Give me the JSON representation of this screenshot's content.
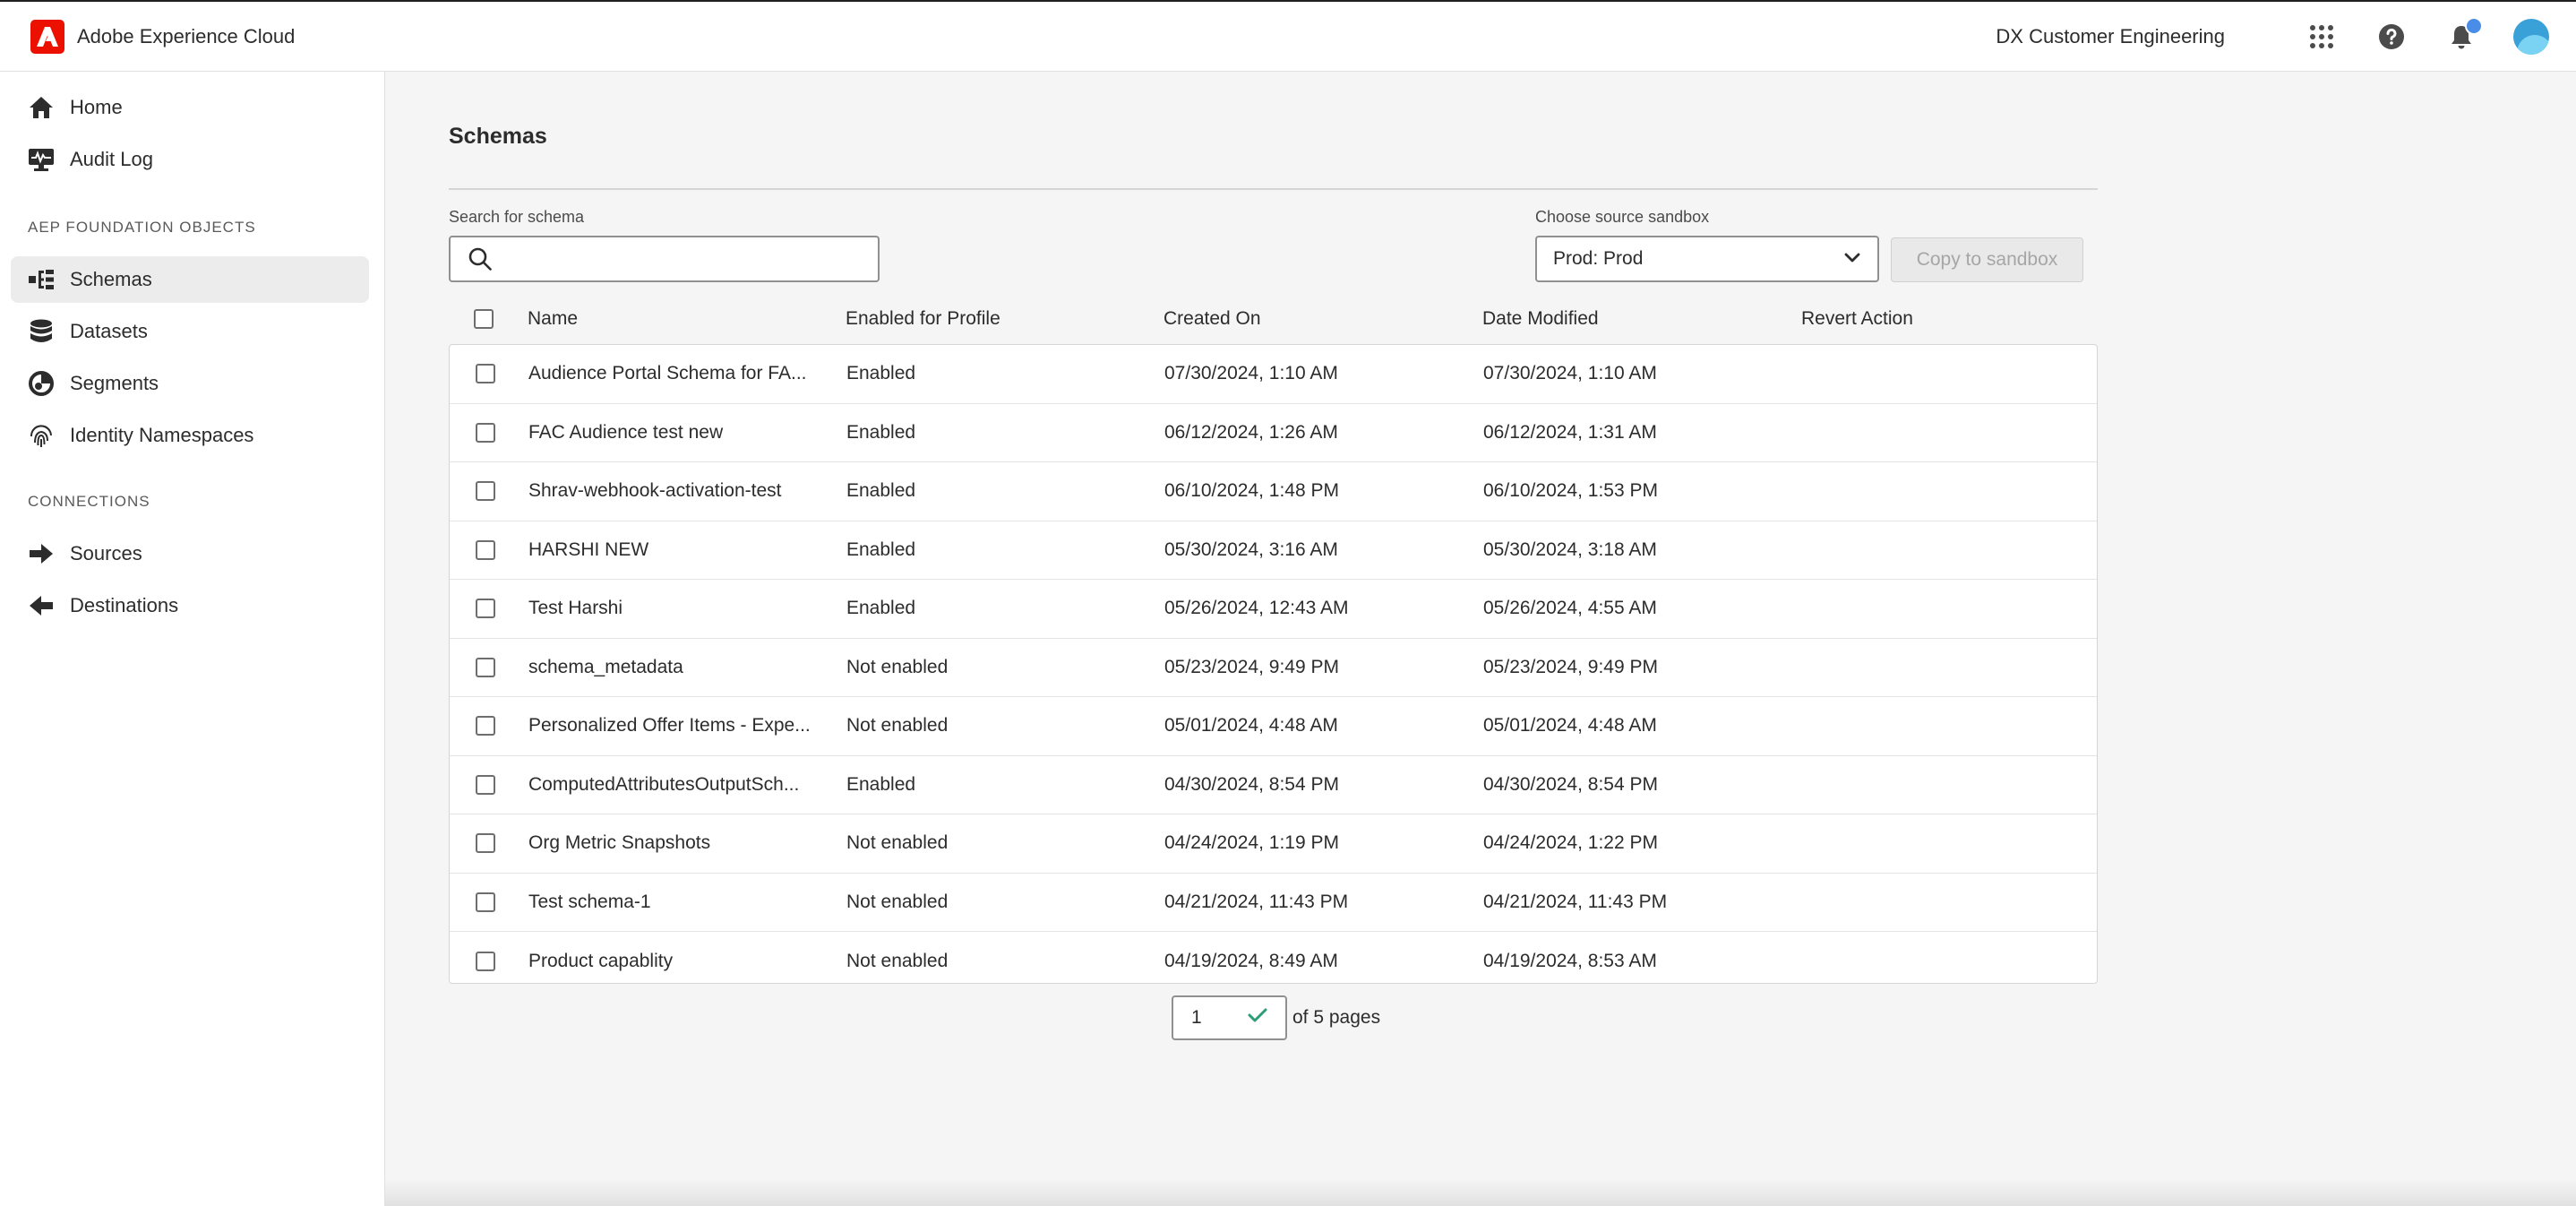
{
  "header": {
    "app_name": "Adobe Experience Cloud",
    "org_name": "DX Customer Engineering",
    "icons": [
      "apps-grid-icon",
      "help-icon",
      "bell-icon",
      "avatar"
    ],
    "brand_color": "#eb1000"
  },
  "sidebar": {
    "top_items": [
      {
        "label": "Home",
        "icon": "home-icon"
      },
      {
        "label": "Audit Log",
        "icon": "monitor-icon"
      }
    ],
    "section1_title": "AEP FOUNDATION OBJECTS",
    "section1_items": [
      {
        "label": "Schemas",
        "icon": "schema-icon",
        "active": true
      },
      {
        "label": "Datasets",
        "icon": "database-icon"
      },
      {
        "label": "Segments",
        "icon": "segments-icon"
      },
      {
        "label": "Identity Namespaces",
        "icon": "fingerprint-icon"
      }
    ],
    "section2_title": "CONNECTIONS",
    "section2_items": [
      {
        "label": "Sources",
        "icon": "arrow-right-icon"
      },
      {
        "label": "Destinations",
        "icon": "arrow-left-icon"
      }
    ]
  },
  "main": {
    "title": "Schemas",
    "search": {
      "label": "Search for schema",
      "value": "",
      "placeholder": ""
    },
    "sandbox": {
      "label": "Choose source sandbox",
      "selected": "Prod: Prod"
    },
    "copy_button": "Copy to sandbox",
    "table": {
      "columns": [
        "Name",
        "Enabled for Profile",
        "Created On",
        "Date Modified",
        "Revert Action"
      ],
      "rows": [
        {
          "name": "Audience Portal Schema for FA...",
          "profile": "Enabled",
          "created": "07/30/2024, 1:10 AM",
          "modified": "07/30/2024, 1:10 AM"
        },
        {
          "name": "FAC Audience test new",
          "profile": "Enabled",
          "created": "06/12/2024, 1:26 AM",
          "modified": "06/12/2024, 1:31 AM"
        },
        {
          "name": "Shrav-webhook-activation-test",
          "profile": "Enabled",
          "created": "06/10/2024, 1:48 PM",
          "modified": "06/10/2024, 1:53 PM"
        },
        {
          "name": "HARSHI NEW",
          "profile": "Enabled",
          "created": "05/30/2024, 3:16 AM",
          "modified": "05/30/2024, 3:18 AM"
        },
        {
          "name": "Test Harshi",
          "profile": "Enabled",
          "created": "05/26/2024, 12:43 AM",
          "modified": "05/26/2024, 4:55 AM"
        },
        {
          "name": "schema_metadata",
          "profile": "Not enabled",
          "created": "05/23/2024, 9:49 PM",
          "modified": "05/23/2024, 9:49 PM"
        },
        {
          "name": "Personalized Offer Items - Expe...",
          "profile": "Not enabled",
          "created": "05/01/2024, 4:48 AM",
          "modified": "05/01/2024, 4:48 AM"
        },
        {
          "name": "ComputedAttributesOutputSch...",
          "profile": "Enabled",
          "created": "04/30/2024, 8:54 PM",
          "modified": "04/30/2024, 8:54 PM"
        },
        {
          "name": "Org Metric Snapshots",
          "profile": "Not enabled",
          "created": "04/24/2024, 1:19 PM",
          "modified": "04/24/2024, 1:22 PM"
        },
        {
          "name": "Test schema-1",
          "profile": "Not enabled",
          "created": "04/21/2024, 11:43 PM",
          "modified": "04/21/2024, 11:43 PM"
        },
        {
          "name": "Product capablity",
          "profile": "Not enabled",
          "created": "04/19/2024, 8:49 AM",
          "modified": "04/19/2024, 8:53 AM"
        }
      ]
    },
    "pagination": {
      "current_page": "1",
      "of_label": "of 5 pages"
    }
  }
}
